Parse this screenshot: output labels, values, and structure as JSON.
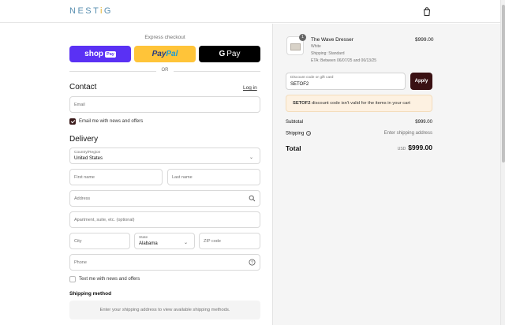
{
  "header": {
    "logo_a": "NEST",
    "logo_o": "i",
    "logo_b": "G"
  },
  "express": {
    "title": "Express checkout",
    "shop_label": "shop",
    "shop_badge": "Pay",
    "paypal_a": "Pay",
    "paypal_b": "Pal",
    "gpay_g": "G",
    "gpay_label": "Pay",
    "or": "OR"
  },
  "contact": {
    "title": "Contact",
    "login": "Log in",
    "email_placeholder": "Email",
    "newsletter_label": "Email me with news and offers",
    "newsletter_checked": true
  },
  "delivery": {
    "title": "Delivery",
    "country_label": "Country/Region",
    "country_value": "United States",
    "first_name_placeholder": "First name",
    "last_name_placeholder": "Last name",
    "address_placeholder": "Address",
    "apartment_placeholder": "Apartment, suite, etc. (optional)",
    "city_placeholder": "City",
    "state_label": "State",
    "state_value": "Alabama",
    "zip_placeholder": "ZIP code",
    "phone_placeholder": "Phone",
    "sms_label": "Text me with news and offers",
    "sms_checked": false
  },
  "shipping_method": {
    "title": "Shipping method",
    "message": "Enter your shipping address to view available shipping methods."
  },
  "summary": {
    "product": {
      "name": "The Wave Dresser",
      "variant": "White",
      "shipping": "Shipping: Standard",
      "eta": "ETA: Between 06/07/25 and 06/13/25",
      "price": "$999.00",
      "quantity": "1"
    },
    "discount_label": "Discount code or gift card",
    "discount_value": "SETOF2",
    "apply_label": "Apply",
    "error_code": "SETOF2",
    "error_text": " discount code isn't valid for the items in your cart",
    "subtotal_label": "Subtotal",
    "subtotal_value": "$999.00",
    "shipping_label": "Shipping",
    "shipping_value": "Enter shipping address",
    "total_label": "Total",
    "total_currency": "USD",
    "total_value": "$999.00"
  },
  "colors": {
    "accent": "#3a1113",
    "shop_pay": "#5a31f4",
    "paypal": "#ffc439",
    "error_bg": "#fdf1e1"
  }
}
